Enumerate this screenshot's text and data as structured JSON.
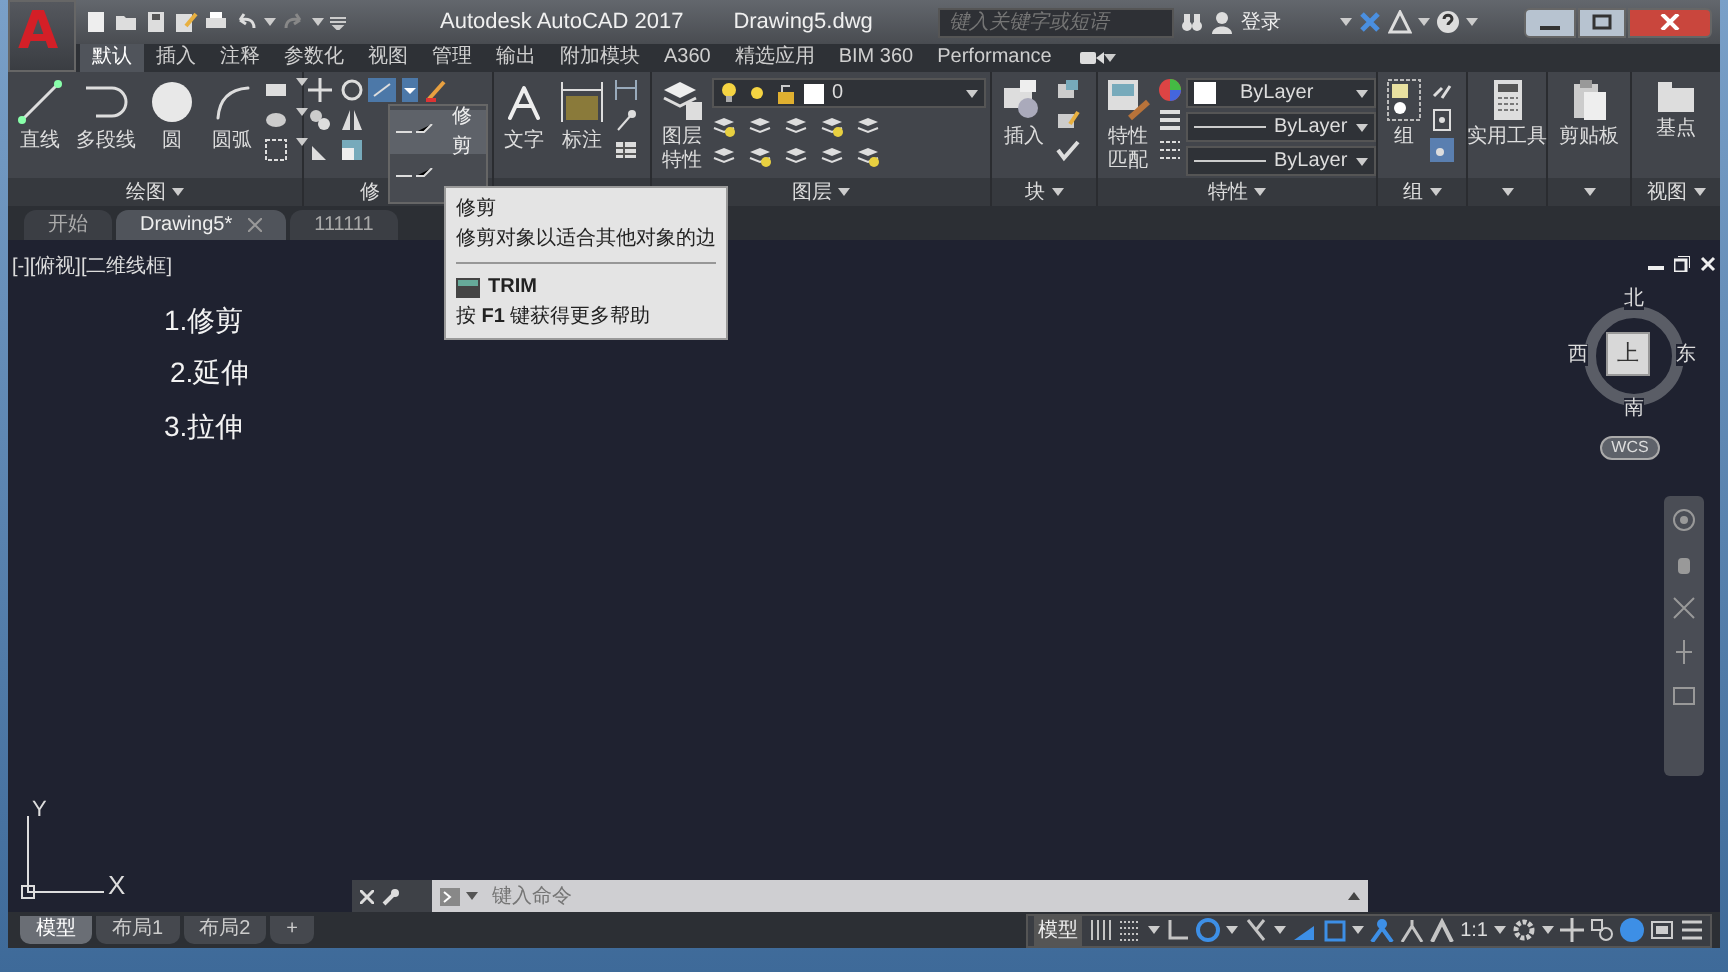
{
  "title_bar": {
    "app_button": "A",
    "title": "Autodesk AutoCAD 2017",
    "file_name": "Drawing5.dwg",
    "search": {
      "placeholder": "键入关键字或短语"
    },
    "sign_in": "登录"
  },
  "ribbon_tabs": [
    {
      "label": "默认",
      "selected": true
    },
    {
      "label": "插入",
      "selected": false
    },
    {
      "label": "注释",
      "selected": false
    },
    {
      "label": "参数化",
      "selected": false
    },
    {
      "label": "视图",
      "selected": false
    },
    {
      "label": "管理",
      "selected": false
    },
    {
      "label": "输出",
      "selected": false
    },
    {
      "label": "附加模块",
      "selected": false
    },
    {
      "label": "A360",
      "selected": false
    },
    {
      "label": "精选应用",
      "selected": false
    },
    {
      "label": "BIM 360",
      "selected": false
    },
    {
      "label": "Performance",
      "selected": false
    }
  ],
  "panels": {
    "draw": {
      "title": "绘图",
      "tools": [
        "直线",
        "多段线",
        "圆",
        "圆弧"
      ]
    },
    "modify": {
      "title": "修",
      "menu": [
        {
          "label": "修剪",
          "selected": true
        },
        {
          "selected": false
        }
      ]
    },
    "annotation": {
      "tools": [
        "文字",
        "标注"
      ]
    },
    "layers": {
      "title": "图层",
      "tool": "图层特性",
      "current_layer": "0"
    },
    "block": {
      "title": "块",
      "tool": "插入"
    },
    "properties": {
      "title": "特性",
      "tool": "特性匹配",
      "color_setting": "ByLayer",
      "linetype": "ByLayer",
      "lineweight": "ByLayer"
    },
    "groups": {
      "title": "组",
      "tool": "组"
    },
    "utilities": {
      "tool": "实用工具"
    },
    "clipboard": {
      "tool": "剪贴板"
    },
    "view": {
      "title": "视图",
      "tool": "基点"
    }
  },
  "tooltip": {
    "title": "修剪",
    "description": "修剪对象以适合其他对象的边",
    "command": "TRIM",
    "help": "按 **F1** 键获得更多帮助"
  },
  "file_tabs": [
    {
      "label": "开始",
      "selected": false
    },
    {
      "label": "Drawing5*",
      "selected": true
    },
    {
      "label": "111111",
      "selected": false
    }
  ],
  "viewport": {
    "label": "[-][俯视][二维线框]",
    "texts": [
      "1.修剪",
      "2.延伸",
      "3.拉伸"
    ],
    "viewcube": {
      "north": "北",
      "west": "西",
      "face": "上",
      "east": "东",
      "south": "南",
      "ucs": "WCS"
    },
    "ucs_icon": {
      "y": "Y",
      "x": "X"
    }
  },
  "command_line": {
    "placeholder": "键入命令"
  },
  "layout_tabs": [
    {
      "label": "模型",
      "selected": true
    },
    {
      "label": "布局1",
      "selected": false
    },
    {
      "label": "布局2",
      "selected": false
    }
  ],
  "add_layout": "+",
  "status_bar": {
    "space": "模型",
    "toggles": [
      {
        "on": false
      },
      {
        "on": false
      },
      {
        "on": false
      },
      {
        "on": true
      },
      {
        "on": false
      },
      {
        "on": true
      },
      {
        "on": true
      },
      {
        "on": true
      },
      {
        "on": false
      },
      {
        "on": false
      },
      {
        "on": true
      }
    ],
    "scale": "1:1"
  }
}
